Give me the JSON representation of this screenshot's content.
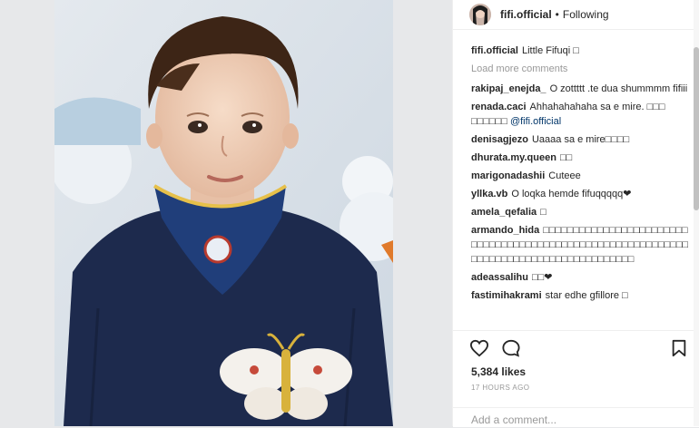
{
  "post": {
    "username": "fifi.official",
    "separator": "•",
    "follow_status": "Following",
    "caption_user": "fifi.official",
    "caption_text": "Little Fifuqi □",
    "load_more": "Load more comments",
    "likes": "5,384 likes",
    "time": "17 HOURS AGO",
    "comment_placeholder": "Add a comment..."
  },
  "comments": [
    {
      "user": "rakipaj_enejda_",
      "text": "O zottttt .te dua shummmm fifiii"
    },
    {
      "user": "renada.caci",
      "text": "Ahhahahahaha sa e mire. □□□ □□□□□□",
      "mention": "@fifi.official"
    },
    {
      "user": "denisagjezo",
      "text": "Uaaaa sa e mire□□□□"
    },
    {
      "user": "dhurata.my.queen",
      "text": "□□"
    },
    {
      "user": "marigonadashii",
      "text": "Cuteee"
    },
    {
      "user": "yllka.vb",
      "text": "O loqka hemde fifuqqqqq❤"
    },
    {
      "user": "amela_qefalia",
      "text": "□"
    },
    {
      "user": "armando_hida",
      "text": "□□□□□□□□□□□□□□□□□□□□□□□□□□□□□□□□□□□□□□□□□□□□□□□□□□□□□□□□□□□□□□□□□□□□□□□□□□□□□□□□□□□□□□□"
    },
    {
      "user": "adeassalihu",
      "text": "□□❤"
    },
    {
      "user": "fastimihakrami",
      "text": "star edhe gfillore □"
    }
  ],
  "icons": {
    "like": "heart-icon",
    "comment": "comment-bubble-icon",
    "save": "bookmark-icon"
  },
  "colors": {
    "background": "#e7e8ea",
    "panel": "#ffffff",
    "text": "#262626",
    "muted": "#999999",
    "mention": "#003569",
    "border": "#efefef"
  }
}
